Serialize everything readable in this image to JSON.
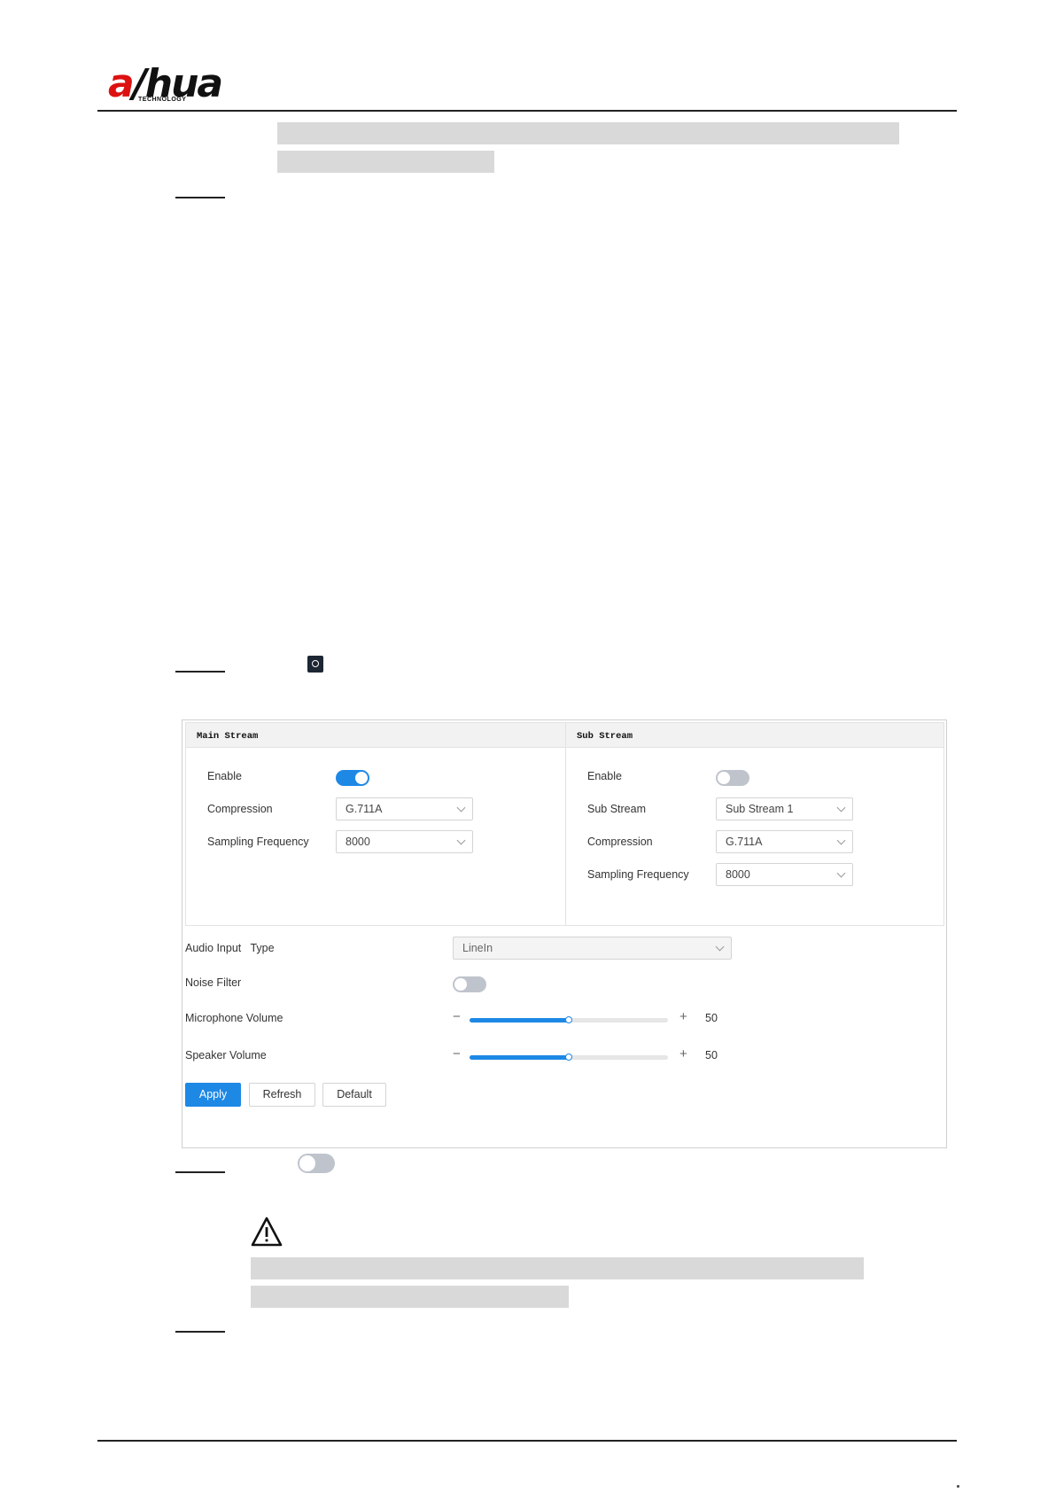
{
  "brand": {
    "logo_text": "a/hua",
    "logo_sub": "TECHNOLOGY"
  },
  "main_stream": {
    "title": "Main Stream",
    "enable_label": "Enable",
    "enable_on": true,
    "compression_label": "Compression",
    "compression_value": "G.711A",
    "sampling_label": "Sampling Frequency",
    "sampling_value": "8000"
  },
  "sub_stream": {
    "title": "Sub Stream",
    "enable_label": "Enable",
    "enable_on": false,
    "stream_label": "Sub Stream",
    "stream_value": "Sub Stream 1",
    "compression_label": "Compression",
    "compression_value": "G.711A",
    "sampling_label": "Sampling Frequency",
    "sampling_value": "8000"
  },
  "audio": {
    "input_type_label": "Audio Input   Type",
    "input_type_value": "LineIn",
    "noise_filter_label": "Noise Filter",
    "noise_filter_on": false,
    "mic_label": "Microphone Volume",
    "mic_value": "50",
    "speaker_label": "Speaker Volume",
    "speaker_value": "50",
    "minus_symbol": "−",
    "plus_symbol": "+"
  },
  "buttons": {
    "apply": "Apply",
    "refresh": "Refresh",
    "default": "Default"
  }
}
